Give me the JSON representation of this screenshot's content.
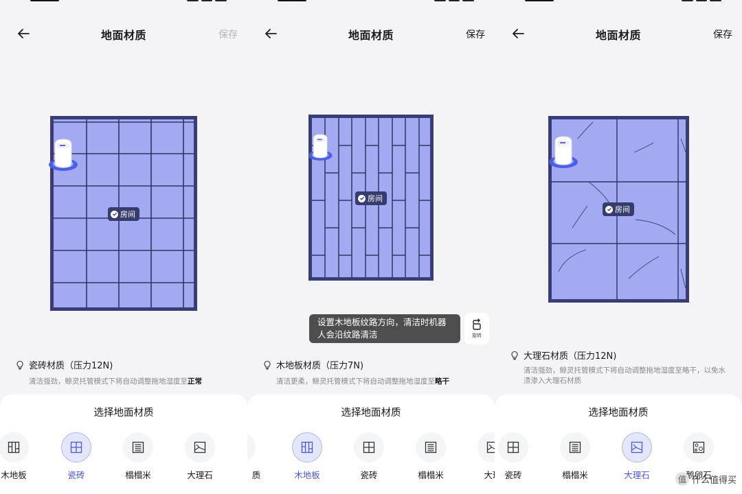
{
  "screens": [
    {
      "title": "地面材质",
      "save_label": "保存",
      "save_enabled": false,
      "room_label": "房间",
      "material_info": {
        "name_label": "瓷砖材质（压力12N)",
        "desc_prefix": "清洁强劲，鲸灵托管模式下将自动调整拖地湿度至",
        "desc_bold": "正常",
        "desc_suffix": ""
      },
      "sheet": {
        "title": "选择地面材质",
        "options": [
          {
            "label": "木地板",
            "icon": "wood-floor-icon",
            "selected": false
          },
          {
            "label": "瓷砖",
            "icon": "tile-floor-icon",
            "selected": true
          },
          {
            "label": "榻榻米",
            "icon": "tatami-floor-icon",
            "selected": false
          },
          {
            "label": "大理石",
            "icon": "marble-floor-icon",
            "selected": false
          }
        ]
      }
    },
    {
      "title": "地面材质",
      "save_label": "保存",
      "save_enabled": true,
      "room_label": "房间",
      "tooltip": "设置木地板纹路方向，清洁时机器人会沿纹路清洁",
      "rotate_label": "旋转",
      "material_info": {
        "name_label": "木地板材质（压力7N)",
        "desc_prefix": "清洁更柔，鲸灵托管模式下将自动调整拖地湿度至",
        "desc_bold": "略干",
        "desc_suffix": ""
      },
      "sheet": {
        "title": "选择地面材质",
        "options": [
          {
            "label": "质",
            "icon": "pebble-floor-icon",
            "selected": false
          },
          {
            "label": "木地板",
            "icon": "wood-floor-icon",
            "selected": true
          },
          {
            "label": "瓷砖",
            "icon": "tile-floor-icon",
            "selected": false
          },
          {
            "label": "榻榻米",
            "icon": "tatami-floor-icon",
            "selected": false
          },
          {
            "label": "大理",
            "icon": "marble-floor-icon",
            "selected": false
          }
        ]
      }
    },
    {
      "title": "地面材质",
      "save_label": "保存",
      "save_enabled": true,
      "room_label": "房间",
      "material_info": {
        "name_label": "大理石材质（压力12N)",
        "desc_prefix": "清洁强劲，鲸灵托管模式下将自动调整拖地湿度至略干，以免水渍渗入大理石材质",
        "desc_bold": "",
        "desc_suffix": ""
      },
      "sheet": {
        "title": "选择地面材质",
        "options": [
          {
            "label": "瓷砖",
            "icon": "tile-floor-icon",
            "selected": false
          },
          {
            "label": "榻榻米",
            "icon": "tatami-floor-icon",
            "selected": false
          },
          {
            "label": "大理石",
            "icon": "marble-floor-icon",
            "selected": true
          },
          {
            "label": "鹅卵石",
            "icon": "pebble-floor-icon",
            "selected": false
          }
        ]
      },
      "watermark": "什么值得买"
    }
  ],
  "colors": {
    "floor_fill": "#a3aaf2",
    "floor_border": "#383e75",
    "selected_accent": "#4a57d8",
    "disabled_text": "#b5b5b5"
  }
}
